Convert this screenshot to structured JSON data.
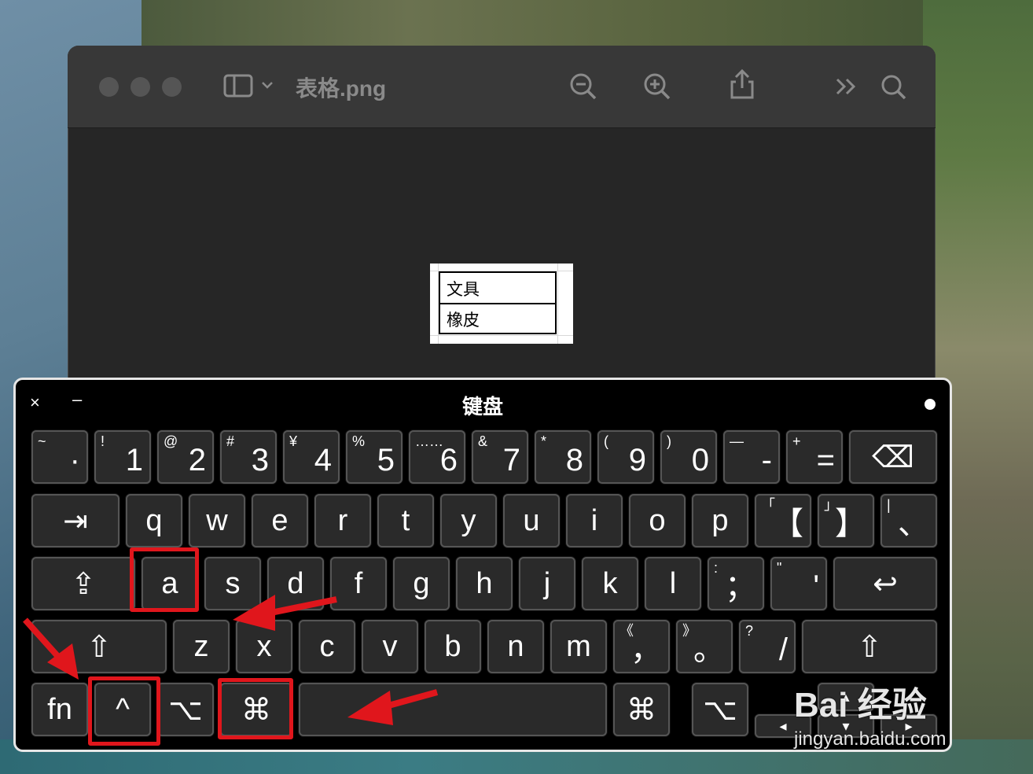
{
  "window": {
    "title": "表格.png",
    "document": {
      "rows": [
        "文具",
        "橡皮"
      ]
    }
  },
  "toolbar": {
    "icons": [
      "sidebar-icon",
      "chevron-down-icon",
      "zoom-out-icon",
      "zoom-in-icon",
      "share-icon",
      "more-icon",
      "search-icon"
    ]
  },
  "keyboard": {
    "title": "键盘",
    "close": "×",
    "minimize": "–",
    "row1": [
      {
        "sub": "~",
        "main": "·"
      },
      {
        "sub": "!",
        "main": "1"
      },
      {
        "sub": "@",
        "main": "2"
      },
      {
        "sub": "#",
        "main": "3"
      },
      {
        "sub": "¥",
        "main": "4"
      },
      {
        "sub": "%",
        "main": "5"
      },
      {
        "sub": "……",
        "main": "6"
      },
      {
        "sub": "&",
        "main": "7"
      },
      {
        "sub": "*",
        "main": "8"
      },
      {
        "sub": "(",
        "main": "9"
      },
      {
        "sub": ")",
        "main": "0"
      },
      {
        "sub": "—",
        "main": "-"
      },
      {
        "sub": "+",
        "main": "="
      },
      {
        "sub": "",
        "main": "⌫"
      }
    ],
    "row2": [
      {
        "sub": "",
        "main": "⇥"
      },
      {
        "sub": "",
        "main": "q"
      },
      {
        "sub": "",
        "main": "w"
      },
      {
        "sub": "",
        "main": "e"
      },
      {
        "sub": "",
        "main": "r"
      },
      {
        "sub": "",
        "main": "t"
      },
      {
        "sub": "",
        "main": "y"
      },
      {
        "sub": "",
        "main": "u"
      },
      {
        "sub": "",
        "main": "i"
      },
      {
        "sub": "",
        "main": "o"
      },
      {
        "sub": "",
        "main": "p"
      },
      {
        "sub": "「",
        "main": "【"
      },
      {
        "sub": "」",
        "main": "】"
      },
      {
        "sub": "|",
        "main": "、"
      }
    ],
    "row3": [
      {
        "sub": "",
        "main": "⇪"
      },
      {
        "sub": "",
        "main": "a"
      },
      {
        "sub": "",
        "main": "s"
      },
      {
        "sub": "",
        "main": "d"
      },
      {
        "sub": "",
        "main": "f"
      },
      {
        "sub": "",
        "main": "g"
      },
      {
        "sub": "",
        "main": "h"
      },
      {
        "sub": "",
        "main": "j"
      },
      {
        "sub": "",
        "main": "k"
      },
      {
        "sub": "",
        "main": "l"
      },
      {
        "sub": ":",
        "main": "；"
      },
      {
        "sub": "\"",
        "main": "'"
      },
      {
        "sub": "",
        "main": "↩"
      }
    ],
    "row4": [
      {
        "sub": "",
        "main": "⇧"
      },
      {
        "sub": "",
        "main": "z"
      },
      {
        "sub": "",
        "main": "x"
      },
      {
        "sub": "",
        "main": "c"
      },
      {
        "sub": "",
        "main": "v"
      },
      {
        "sub": "",
        "main": "b"
      },
      {
        "sub": "",
        "main": "n"
      },
      {
        "sub": "",
        "main": "m"
      },
      {
        "sub": "《",
        "main": "，"
      },
      {
        "sub": "》",
        "main": "。"
      },
      {
        "sub": "?",
        "main": "/"
      },
      {
        "sub": "",
        "main": "⇧"
      }
    ],
    "row5": [
      {
        "sub": "",
        "main": "fn"
      },
      {
        "sub": "",
        "main": "^"
      },
      {
        "sub": "",
        "main": "⌥"
      },
      {
        "sub": "",
        "main": "⌘"
      },
      {
        "sub": "",
        "main": ""
      },
      {
        "sub": "",
        "main": "⌘"
      },
      {
        "sub": "",
        "main": "⌥"
      }
    ],
    "arrows": {
      "left": "◂",
      "up": "▴",
      "down": "▾",
      "right": "▸"
    }
  },
  "annotations": {
    "highlight_color": "#e0161c",
    "highlighted_keys": [
      "a",
      "^",
      "⌘"
    ]
  },
  "watermark": {
    "brand": "Bai 经验",
    "url": "jingyan.baidu.com"
  }
}
